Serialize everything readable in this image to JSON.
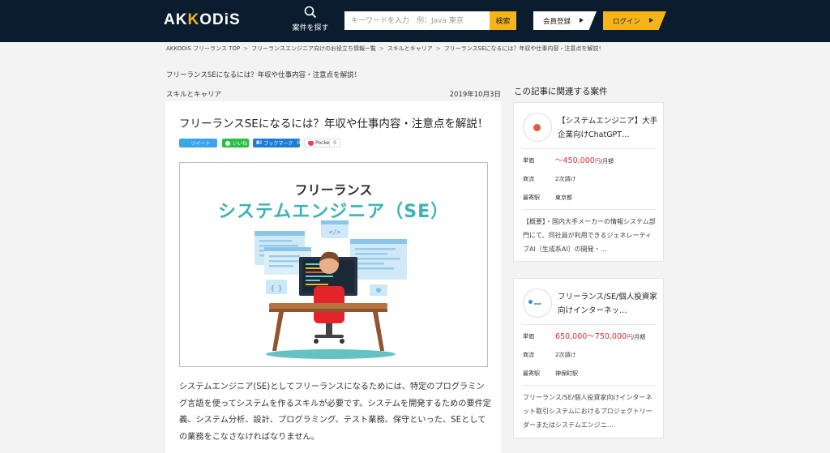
{
  "header": {
    "logo": "AKKODIS",
    "search_nav_label": "案件を探す",
    "search_placeholder": "キーワードを入力　例：Java 東京",
    "search_button": "検索",
    "register_button": "会員登録",
    "login_button": "ログイン"
  },
  "breadcrumb": [
    "AKKODiS フリーランス TOP",
    "フリーランスエンジニア向けのお役立ち情報一覧",
    "スキルとキャリア",
    "フリーランスSEになるには？年収や仕事内容・注意点を解説！"
  ],
  "article": {
    "headline": "フリーランスSEになるには？年収や仕事内容・注意点を解説！",
    "category": "スキルとキャリア",
    "date": "2019年10月3日",
    "title": "フリーランスSEになるには？年収や仕事内容・注意点を解説！",
    "share": {
      "tweet": "ツイート",
      "line": "いいね",
      "hatena": "ブックマーク",
      "hatena_count": "0",
      "pocket": "Pocket",
      "pocket_count": "0"
    },
    "hero": {
      "line1": "フリーランス",
      "line2": "システムエンジニア（SE）"
    },
    "body": "システムエンジニア(SE)としてフリーランスになるためには、特定のプログラミング言語を使ってシステムを作るスキルが必要です。システムを開発するための要件定義、システム分析、設計、プログラミング、テスト業務、保守といった、SEとしての業務をこなさなければなりません。"
  },
  "sidebar": {
    "title": "この記事に関連する案件",
    "labels": {
      "price": "単価",
      "flow": "商流",
      "station": "最寄駅"
    },
    "jobs": [
      {
        "title": "【システムエンジニア】大手企業向けChatGPT…",
        "price_prefix": "～",
        "price": "450,000",
        "price_unit": "円",
        "price_period": "/月額",
        "flow": "2次請け",
        "station": "東京都",
        "desc": "【概要】・国内大手メーカーの情報システム部門にて、同社員が利用できるジェネレーティブAI（生成系AI）の開発・…",
        "logo_color": "#e5593b"
      },
      {
        "title": "フリーランス/SE/個人投資家向けインターネッ…",
        "price_prefix": "",
        "price": "650,000～750,000",
        "price_unit": "円",
        "price_period": "/月額",
        "flow": "2次請け",
        "station": "神保町駅",
        "desc": "フリーランス/SE/個人投資家向けインターネット取引システムにおけるプロジェクトリーダーまたはシステムエンジニ…",
        "logo_color": "#3a8fd4"
      }
    ]
  },
  "colors": {
    "header_bg": "#0b1c2e",
    "accent": "#f6b418",
    "price": "#d6313b",
    "hero_teal": "#3eb3b4"
  }
}
